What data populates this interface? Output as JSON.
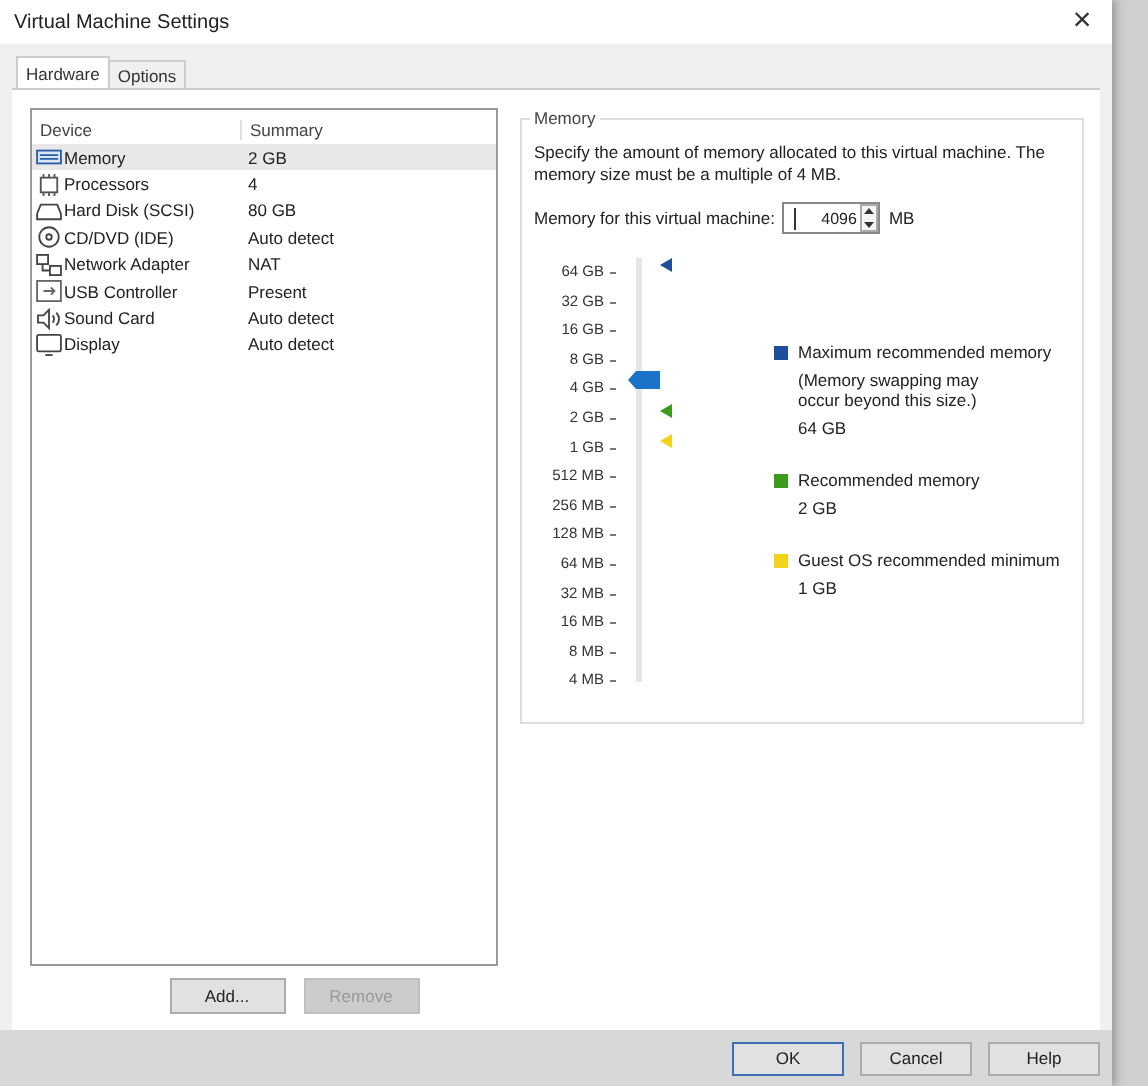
{
  "window": {
    "title": "Virtual Machine Settings",
    "close": "×"
  },
  "tabs": [
    {
      "label": "Hardware",
      "selected": true
    },
    {
      "label": "Options",
      "selected": false
    }
  ],
  "device_table": {
    "columns": [
      "Device",
      "Summary"
    ],
    "rows": [
      {
        "kind": "memory",
        "device": "Memory",
        "summary": "2 GB",
        "selected": true
      },
      {
        "kind": "cpu",
        "device": "Processors",
        "summary": "4",
        "selected": false
      },
      {
        "kind": "disk",
        "device": "Hard Disk (SCSI)",
        "summary": "80 GB",
        "selected": false
      },
      {
        "kind": "cd",
        "device": "CD/DVD (IDE)",
        "summary": "Auto detect",
        "selected": false
      },
      {
        "kind": "network",
        "device": "Network Adapter",
        "summary": "NAT",
        "selected": false
      },
      {
        "kind": "usb",
        "device": "USB Controller",
        "summary": "Present",
        "selected": false
      },
      {
        "kind": "sound",
        "device": "Sound Card",
        "summary": "Auto detect",
        "selected": false
      },
      {
        "kind": "display",
        "device": "Display",
        "summary": "Auto detect",
        "selected": false
      }
    ]
  },
  "device_buttons": [
    {
      "label": "Add...",
      "disabled": false
    },
    {
      "label": "Remove",
      "disabled": true
    }
  ],
  "memory": {
    "title": "Memory",
    "description": "Specify the amount of memory allocated to this virtual machine. The memory size must be a multiple of 4 MB.",
    "field_label": "Memory for this virtual machine:",
    "value": "4096",
    "unit": "MB",
    "slider": {
      "ticks": [
        "64 GB",
        "32 GB",
        "16 GB",
        "8 GB",
        "4 GB",
        "2 GB",
        "1 GB",
        "512 MB",
        "256 MB",
        "128 MB",
        "64 MB",
        "32 MB",
        "16 MB",
        "8 MB",
        "4 MB"
      ],
      "level": 0.714,
      "markers": [
        {
          "color": "#1f4e9c",
          "level": 1
        },
        {
          "color": "#3c9a1e",
          "level": 0.643
        },
        {
          "color": "#f2d21a",
          "level": 0.571
        }
      ]
    },
    "legend": [
      {
        "color": "#1f4e9c",
        "label": "Maximum recommended memory",
        "note": "(Memory swapping may occur beyond this size.)",
        "value": "64 GB"
      },
      {
        "color": "#3c9a1e",
        "label": "Recommended memory",
        "value": "2 GB"
      },
      {
        "color": "#f2d21a",
        "label": "Guest OS recommended minimum",
        "value": "1 GB"
      }
    ]
  },
  "footer_buttons": [
    {
      "label": "OK",
      "default": true
    },
    {
      "label": "Cancel",
      "default": false
    },
    {
      "label": "Help",
      "default": false
    }
  ]
}
